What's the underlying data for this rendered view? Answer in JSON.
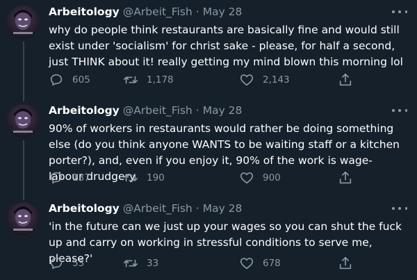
{
  "colors": {
    "background": "#15202b",
    "text": "#ffffff",
    "secondary": "#8b98a5",
    "thread_line": "#38444d"
  },
  "tweets": [
    {
      "display_name": "Arbeitology",
      "handle": "@Arbeit_Fish",
      "separator": "·",
      "date": "May 28",
      "text": "why do people think restaurants are basically fine and would still exist under 'socialism' for christ sake - please, for half a second, just THINK about it! really getting my mind blown this morning lol",
      "replies": "605",
      "retweets": "1,178",
      "likes": "2,143"
    },
    {
      "display_name": "Arbeitology",
      "handle": "@Arbeit_Fish",
      "separator": "·",
      "date": "May 28",
      "text": "90% of workers in restaurants would rather be doing something else (do you think anyone WANTS to be waiting staff or a kitchen porter?), and, even if you enjoy it, 90% of the work is wage-labour drudgery",
      "replies": "137",
      "retweets": "190",
      "likes": "900"
    },
    {
      "display_name": "Arbeitology",
      "handle": "@Arbeit_Fish",
      "separator": "·",
      "date": "May 28",
      "text": "'in the future can we just up your wages so you can shut the fuck up and carry on working in stressful conditions to serve me, please?'",
      "replies": "53",
      "retweets": "33",
      "likes": "678"
    }
  ],
  "icons": {
    "reply": "reply-icon",
    "retweet": "retweet-icon",
    "like": "heart-icon",
    "share": "share-icon",
    "more": "more-icon"
  }
}
